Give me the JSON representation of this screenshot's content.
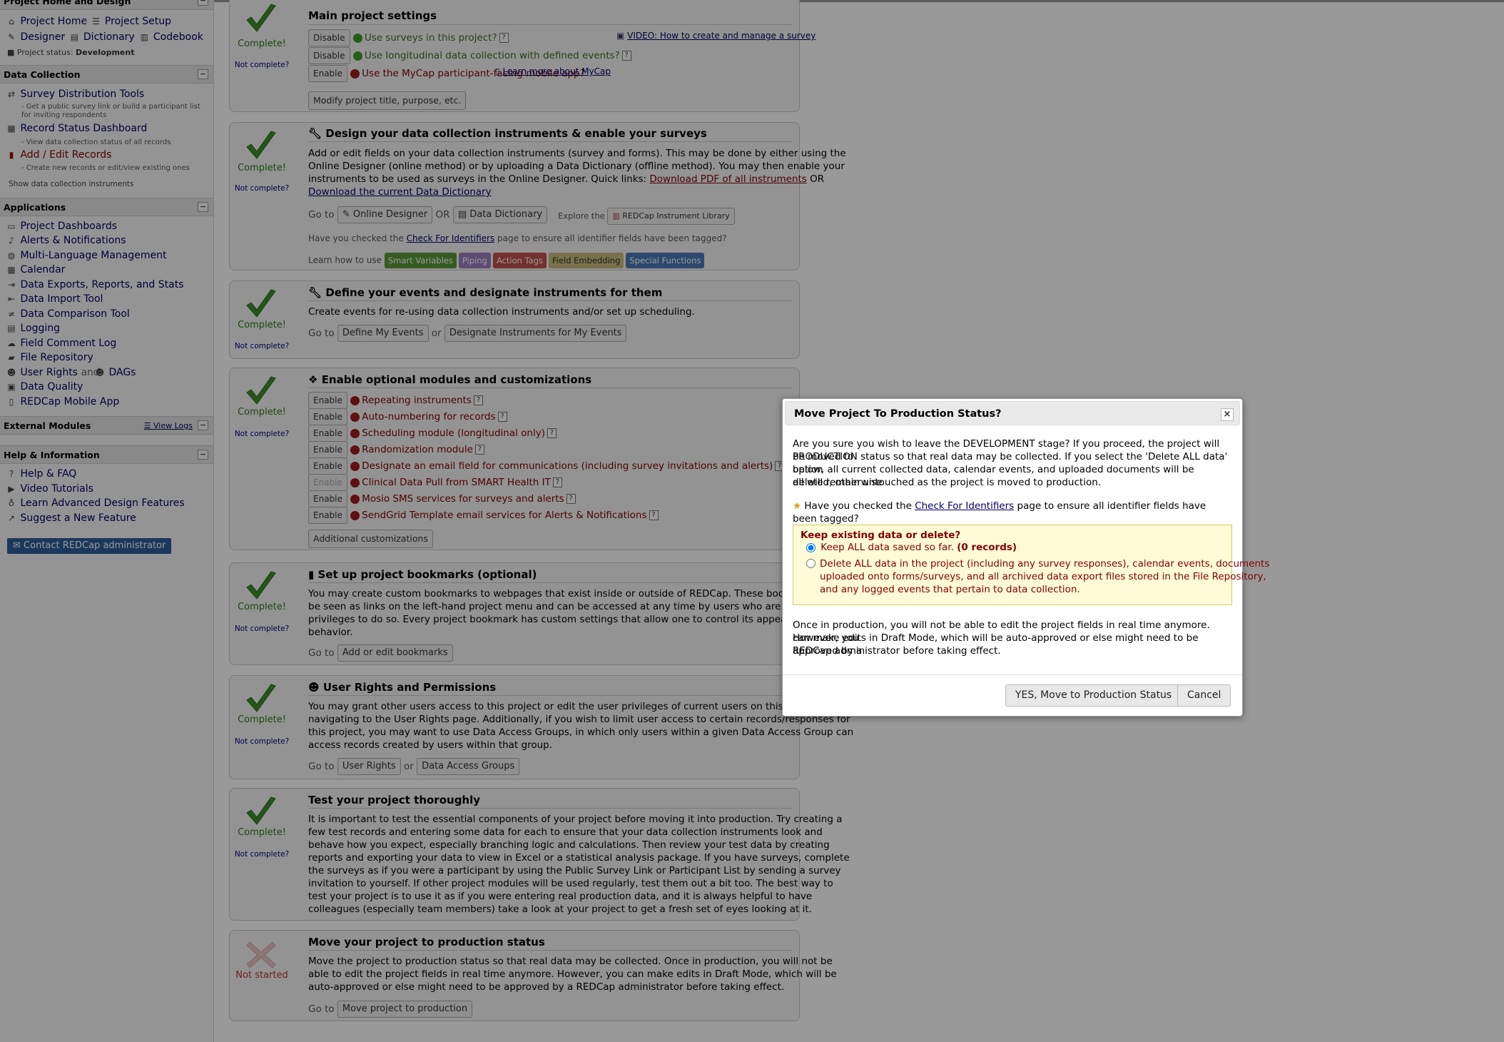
{
  "sidebar": {
    "home_design": {
      "header": "Project Home and Design",
      "project_home": "Project Home",
      "project_setup": "Project Setup",
      "designer": "Designer",
      "dictionary": "Dictionary",
      "codebook": "Codebook",
      "status_label": "Project status:",
      "status_value": "Development"
    },
    "data_collection": {
      "header": "Data Collection",
      "items": [
        {
          "label": "Survey Distribution Tools",
          "sub": "- Get a public survey link or build a participant list for inviting respondents"
        },
        {
          "label": "Record Status Dashboard",
          "sub": "- View data collection status of all records"
        },
        {
          "label": "Add / Edit Records",
          "sub": "- Create new records or edit/view existing ones"
        }
      ],
      "show_instruments": "Show data collection instruments"
    },
    "applications": {
      "header": "Applications",
      "items": [
        "Project Dashboards",
        "Alerts & Notifications",
        "Multi-Language Management",
        "Calendar",
        "Data Exports, Reports, and Stats",
        "Data Import Tool",
        "Data Comparison Tool",
        "Logging",
        "Field Comment Log",
        "File Repository",
        "User Rights",
        "DAGs",
        "Data Quality",
        "REDCap Mobile App"
      ],
      "and": "and"
    },
    "external_modules": {
      "header": "External Modules",
      "view_logs": "View Logs"
    },
    "help": {
      "header": "Help & Information",
      "items": [
        "Help & FAQ",
        "Video Tutorials",
        "Learn Advanced Design Features",
        "Suggest a New Feature"
      ],
      "contact": "Contact REDCap administrator"
    }
  },
  "status": {
    "complete": "Complete!",
    "not_complete": "Not complete?",
    "not_started": "Not started"
  },
  "cards": {
    "main": {
      "title": "Main project settings",
      "disable": "Disable",
      "enable": "Enable",
      "surveys": "Use surveys in this project?",
      "longitudinal": "Use longitudinal data collection with defined events?",
      "mycap": "Use the MyCap participant-facing mobile app?",
      "video": "VIDEO: How to create and manage a survey",
      "learn_mycap": "Learn more about MyCap",
      "modify": "Modify project title, purpose, etc."
    },
    "design": {
      "title": "Design your data collection instruments & enable your surveys",
      "line1": "Add or edit fields on your data collection instruments (survey and forms). This may be done by either using the",
      "line2": "Online Designer (online method) or by uploading a Data Dictionary (offline method). You may then enable your",
      "line3": "instruments to be used as surveys in the Online Designer. Quick links:",
      "pdf_link": "Download PDF of all instruments",
      "or": "OR",
      "dd_link": "Download the current Data Dictionary",
      "goto": "Go to",
      "online_designer": "Online Designer",
      "data_dictionary": "Data Dictionary",
      "explore": "Explore the",
      "library": "REDCap Instrument Library",
      "checked_pre": "Have you checked the",
      "checked_link": "Check For Identifiers",
      "checked_post": "page to ensure all identifier fields have been tagged?",
      "learn": "Learn how to use",
      "badges": [
        "Smart Variables",
        "Piping",
        "Action Tags",
        "Field Embedding",
        "Special Functions"
      ]
    },
    "events": {
      "title": "Define your events and designate instruments for them",
      "line": "Create events for re-using data collection instruments and/or set up scheduling.",
      "goto": "Go to",
      "define": "Define My Events",
      "or": "or",
      "designate": "Designate Instruments for My Events"
    },
    "modules": {
      "title": "Enable optional modules and customizations",
      "enable": "Enable",
      "items": [
        "Repeating instruments",
        "Auto-numbering for records",
        "Scheduling module (longitudinal only)",
        "Randomization module",
        "Designate an email field for communications (including survey invitations and alerts)",
        "Clinical Data Pull from SMART Health IT",
        "Mosio SMS services for surveys and alerts",
        "SendGrid Template email services for Alerts & Notifications"
      ],
      "additional": "Additional customizations"
    },
    "bookmarks": {
      "title": "Set up project bookmarks (optional)",
      "lines": [
        "You may create custom bookmarks to webpages that exist inside or outside of REDCap. These bookmarks will",
        "be seen as links on the left-hand project menu and can be accessed at any time by users who are given",
        "privileges to do so. Every project bookmark has custom settings that allow one to control its appearance and",
        "behavior."
      ],
      "goto": "Go to",
      "button": "Add or edit bookmarks"
    },
    "rights": {
      "title": "User Rights and Permissions",
      "lines": [
        "You may grant other users access to this project or edit the user privileges of current users on this project by",
        "navigating to the User Rights page. Additionally, if you wish to limit user access to certain records/responses for",
        "this project, you may want to use Data Access Groups, in which only users within a given Data Access Group can",
        "access records created by users within that group."
      ],
      "goto": "Go to",
      "user_rights": "User Rights",
      "or": "or",
      "dag": "Data Access Groups"
    },
    "test": {
      "title": "Test your project thoroughly",
      "lines": [
        "It is important to test the essential components of your project before moving it into production. Try creating a",
        "few test records and entering some data for each to ensure that your data collection instruments look and",
        "behave how you expect, especially branching logic and calculations. Then review your test data by creating",
        "reports and exporting your data to view in Excel or a statistical analysis package. If you have surveys, complete",
        "the surveys as if you were a participant by using the Public Survey Link or Participant List by sending a survey",
        "invitation to yourself. If other project modules will be used regularly, test them out a bit too. The best way to",
        "test your project is to use it as if you were entering real production data, and it is always helpful to have",
        "colleagues (especially team members) take a look at your project to get a fresh set of eyes looking at it."
      ]
    },
    "production": {
      "title": "Move your project to production status",
      "lines": [
        "Move the project to production status so that real data may be collected. Once in production, you will not be",
        "able to edit the project fields in real time anymore. However, you can make edits in Draft Mode, which will be",
        "auto-approved or else might need to be approved by a REDCap administrator before taking effect."
      ],
      "goto": "Go to",
      "button": "Move project to production"
    }
  },
  "dialog": {
    "title": "Move Project To Production Status?",
    "intro": [
      "Are you sure you wish to leave the DEVELOPMENT stage? If you proceed, the project will be moved to",
      "PRODUCTION status so that real data may be collected. If you select the 'Delete ALL data' option",
      "below, all current collected data, calendar events, and uploaded documents will be deleted, otherwise",
      "all will remain untouched as the project is moved to production."
    ],
    "check_pre": "Have you checked the",
    "check_link": "Check For Identifiers",
    "check_post": "page to ensure all identifier fields have been tagged?",
    "keep_title": "Keep existing data or delete?",
    "keep_label": "Keep ALL data saved so far.",
    "keep_count": "(0 records)",
    "delete_lines": [
      "Delete ALL data in the project (including any survey responses), calendar events, documents",
      "uploaded onto forms/surveys, and all archived data export files stored in the File Repository,",
      "and any logged events that pertain to data collection."
    ],
    "outro": [
      "Once in production, you will not be able to edit the project fields in real time anymore. However, you",
      "can make edits in Draft Mode, which will be auto-approved or else might need to be approved by a",
      "REDCap administrator before taking effect."
    ],
    "yes": "YES, Move to Production Status",
    "cancel": "Cancel",
    "close": "×"
  },
  "colors": {
    "complete_green": "#2c7a1b",
    "not_complete_blue": "#000080",
    "link": "#000066",
    "enabled_dot": "#3b9b2a",
    "disabled_dot": "#9e1b1b",
    "notice_bg": "#fffbd6"
  },
  "icons": [
    "home-icon",
    "list-icon",
    "pencil-icon",
    "book-icon",
    "codebook-icon",
    "survey-tools-icon",
    "dashboard-icon",
    "records-icon",
    "bell-icon",
    "globe-icon",
    "calendar-icon",
    "export-icon",
    "import-icon",
    "compare-icon",
    "logging-icon",
    "comment-icon",
    "folder-icon",
    "user-icon",
    "group-icon",
    "quality-icon",
    "mobile-icon",
    "help-icon",
    "video-icon",
    "bulb-icon",
    "share-icon",
    "mail-icon",
    "checkmark-icon",
    "x-icon",
    "wrench-icon",
    "cubes-icon",
    "bookmark-icon",
    "star-icon",
    "close-icon"
  ]
}
